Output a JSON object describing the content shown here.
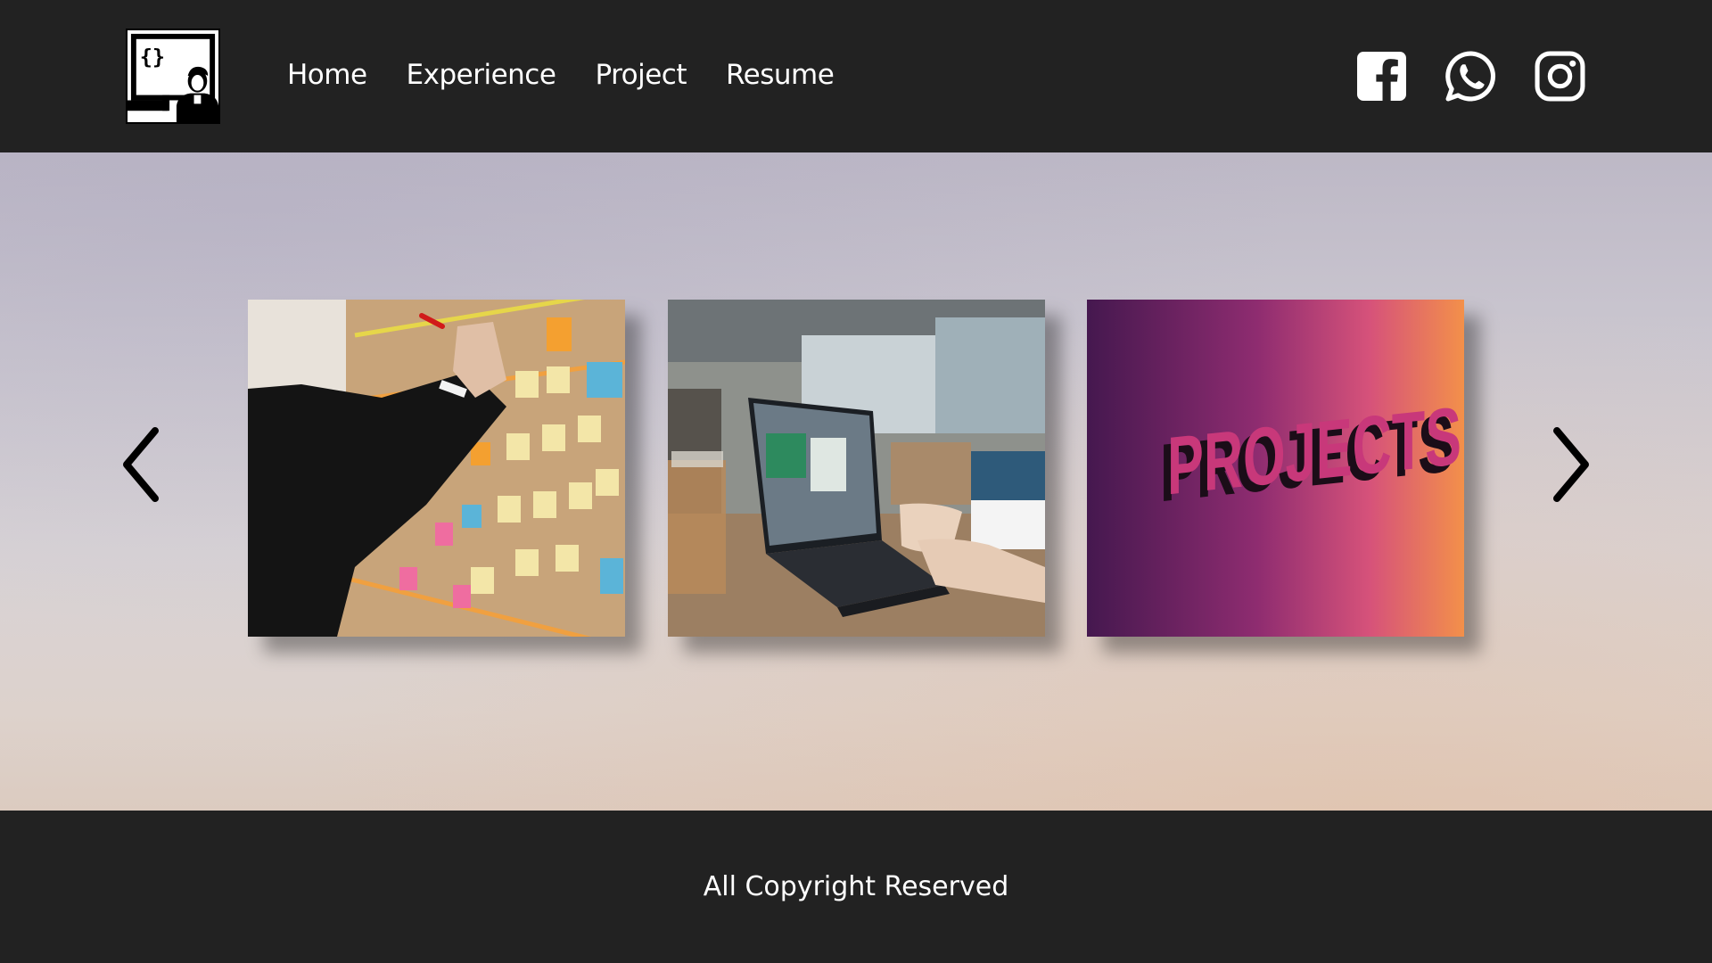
{
  "header": {
    "logo_icon": "developer-logo-icon",
    "nav": [
      {
        "label": "Home"
      },
      {
        "label": "Experience"
      },
      {
        "label": "Project"
      },
      {
        "label": "Resume"
      }
    ],
    "social": [
      "facebook-icon",
      "whatsapp-icon",
      "instagram-icon"
    ]
  },
  "carousel": {
    "prev_icon": "chevron-left-icon",
    "next_icon": "chevron-right-icon",
    "slides": [
      {
        "image": "sticky-notes-board-photo"
      },
      {
        "image": "laptop-cafe-photo"
      },
      {
        "image": "projects-sign-photo",
        "sign_text": "PROJECTS"
      }
    ]
  },
  "footer": {
    "text": "All Copyright Reserved"
  },
  "colors": {
    "bar": "#222222",
    "text": "#ffffff"
  }
}
